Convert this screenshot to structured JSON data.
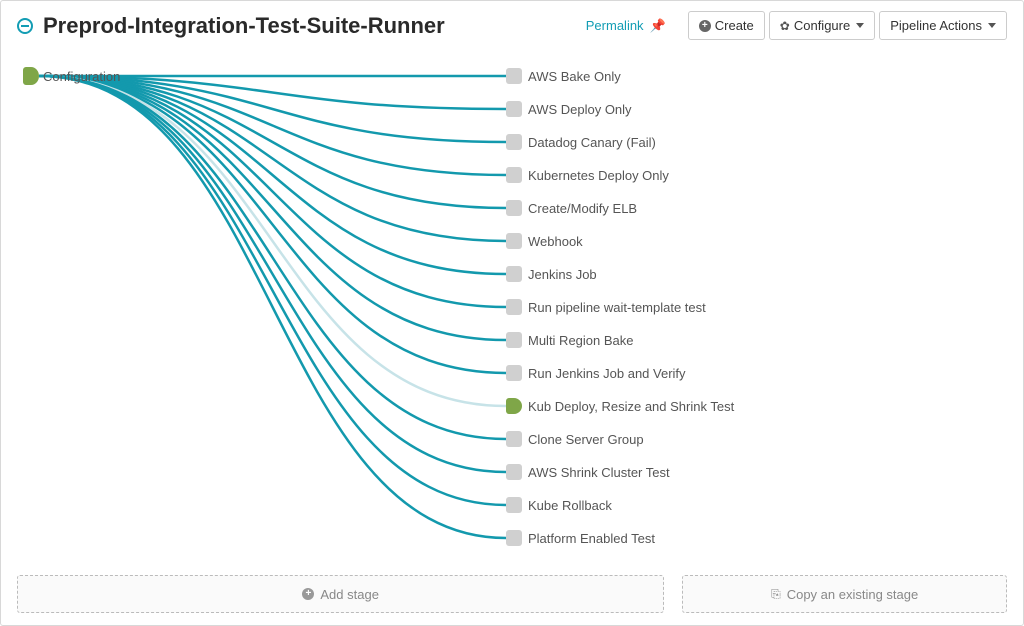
{
  "title": "Preprod-Integration-Test-Suite-Runner",
  "permalink_label": "Permalink",
  "buttons": {
    "create": "Create",
    "configure": "Configure",
    "pipeline_actions": "Pipeline Actions"
  },
  "start_node": "Configuration",
  "stages": [
    {
      "label": "AWS Bake Only",
      "selected": false
    },
    {
      "label": "AWS Deploy Only",
      "selected": false
    },
    {
      "label": "Datadog Canary (Fail)",
      "selected": false
    },
    {
      "label": "Kubernetes Deploy Only",
      "selected": false
    },
    {
      "label": "Create/Modify ELB",
      "selected": false
    },
    {
      "label": "Webhook",
      "selected": false
    },
    {
      "label": "Jenkins Job",
      "selected": false
    },
    {
      "label": "Run pipeline wait-template test",
      "selected": false
    },
    {
      "label": "Multi Region Bake",
      "selected": false
    },
    {
      "label": "Run Jenkins Job and Verify",
      "selected": false
    },
    {
      "label": "Kub Deploy, Resize and Shrink Test",
      "selected": true
    },
    {
      "label": "Clone Server Group",
      "selected": false
    },
    {
      "label": "AWS Shrink Cluster Test",
      "selected": false
    },
    {
      "label": "Kube Rollback",
      "selected": false
    },
    {
      "label": "Platform Enabled Test",
      "selected": false
    }
  ],
  "footer": {
    "add_stage": "Add stage",
    "copy_stage": "Copy an existing stage"
  },
  "colors": {
    "edge": "#1399ad",
    "edge_light": "#c7e3e8",
    "green": "#7fa648"
  }
}
